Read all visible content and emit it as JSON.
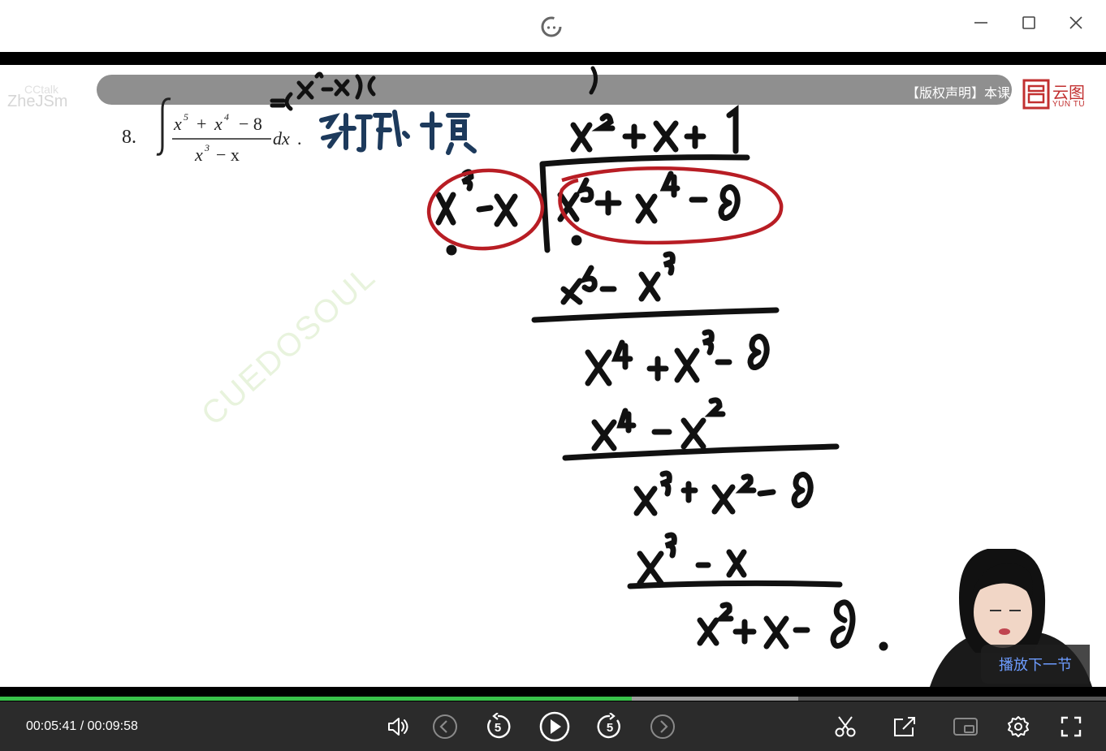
{
  "window": {
    "minimize_icon": "minimize-icon",
    "maximize_icon": "maximize-icon",
    "close_icon": "close-icon"
  },
  "video": {
    "notice": "【版权声明】本课",
    "brand_name": "云图",
    "brand_sub": "YUN TU",
    "watermark_top_1": "CCtalk",
    "watermark_top_2": "ZheJSm",
    "watermark_diagonal": "CUEDOSOUL",
    "problem_number": "8.",
    "next_lesson_label": "播放下一节"
  },
  "player": {
    "current_time": "00:05:41",
    "separator": "/",
    "total_time": "00:09:58",
    "progress_fraction": 0.571,
    "buffered_fraction": 0.722,
    "accent_color": "#39c24a",
    "rewind_seconds": "5",
    "forward_seconds": "5"
  }
}
